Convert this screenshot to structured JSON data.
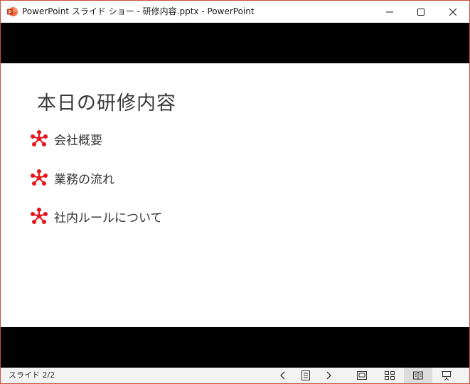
{
  "window": {
    "title": "PowerPoint スライド ショー  -  研修内容.pptx - PowerPoint",
    "app_icon": "powerpoint-icon",
    "controls": [
      "minimize-icon",
      "maximize-icon",
      "close-icon"
    ]
  },
  "slide": {
    "title": "本日の研修内容",
    "bullets": [
      {
        "text": "会社概要"
      },
      {
        "text": "業務の流れ"
      },
      {
        "text": "社内ルールについて"
      }
    ],
    "bullet_icon": "network-star-icon",
    "bullet_color": "#e8141b"
  },
  "statusbar": {
    "slide_indicator": "スライド 2/2",
    "buttons": [
      "previous-slide-icon",
      "notes-icon",
      "next-slide-icon",
      "normal-view-icon",
      "slide-sorter-icon",
      "reading-view-icon",
      "slideshow-icon"
    ]
  },
  "colors": {
    "window_border": "#c7513f",
    "letterbox": "#000000",
    "statusbar_bg": "#f3f3f3"
  }
}
